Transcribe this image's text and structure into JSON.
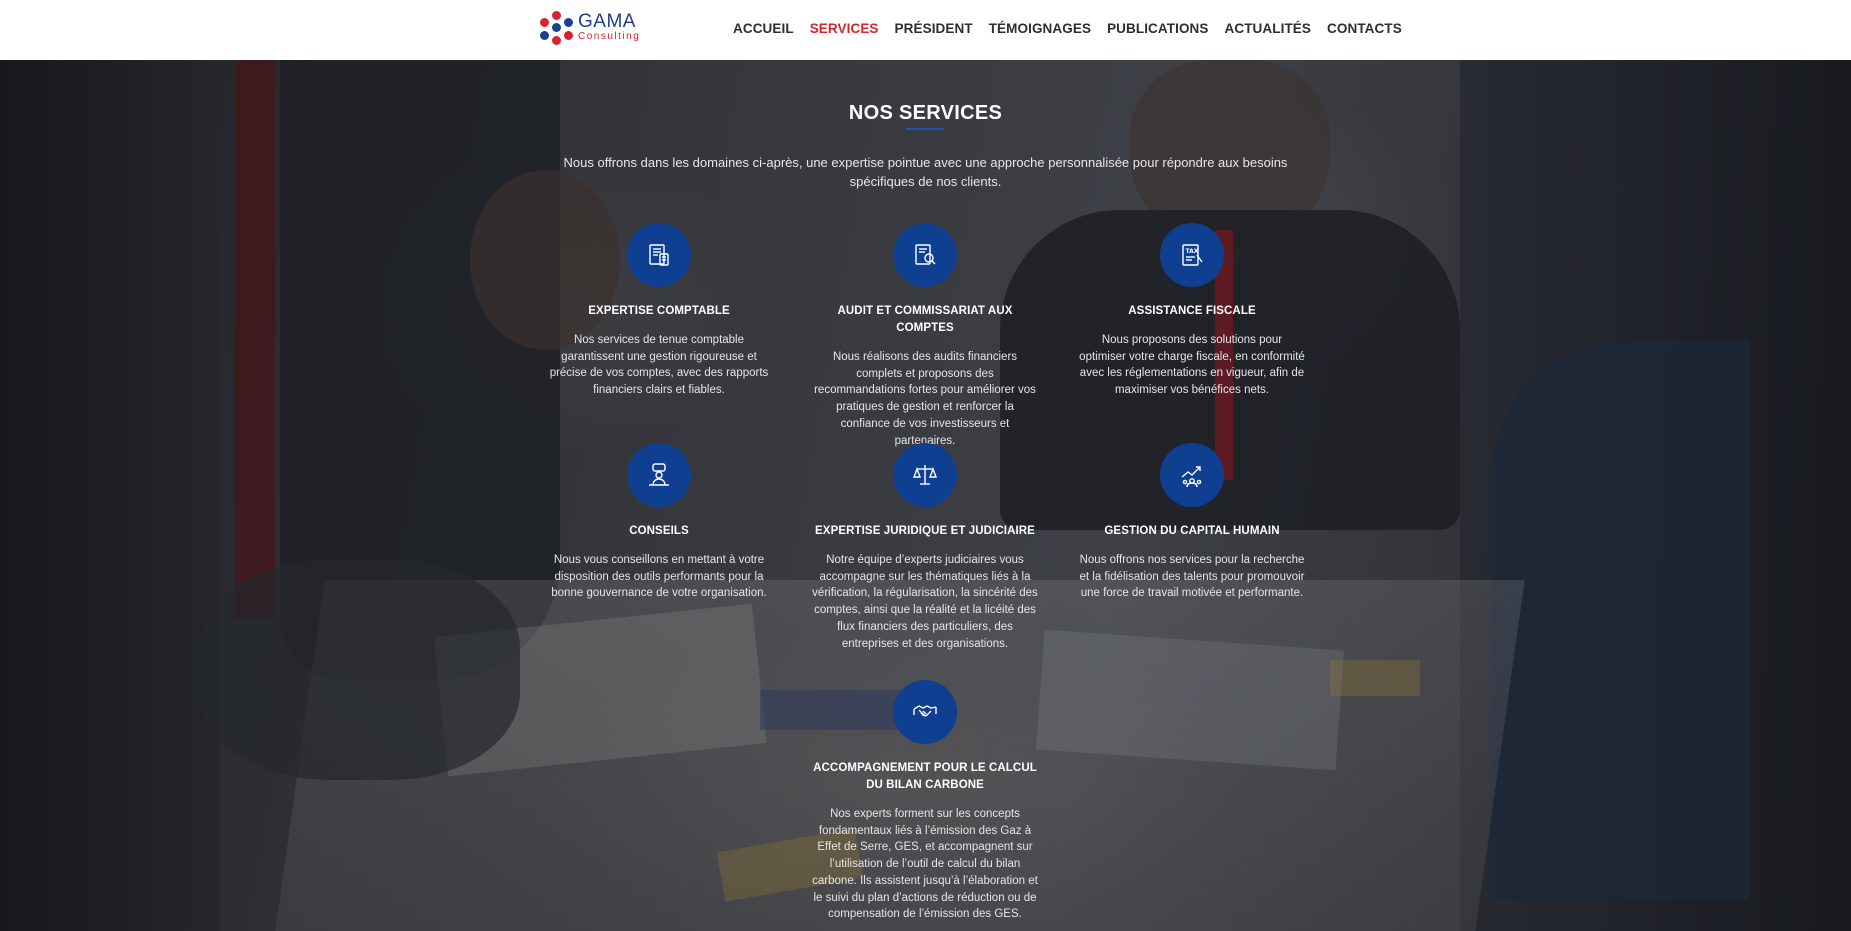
{
  "header": {
    "logo": {
      "title": "GAMA",
      "subtitle": "Consulting",
      "tagline": ""
    },
    "nav": [
      {
        "label": "ACCUEIL",
        "active": false
      },
      {
        "label": "SERVICES",
        "active": true
      },
      {
        "label": "PRÉSIDENT",
        "active": false
      },
      {
        "label": "TÉMOIGNAGES",
        "active": false
      },
      {
        "label": "PUBLICATIONS",
        "active": false
      },
      {
        "label": "ACTUALITÉS",
        "active": false
      },
      {
        "label": "CONTACTS",
        "active": false
      }
    ]
  },
  "section": {
    "title": "NOS SERVICES",
    "intro": "Nous offrons dans les domaines ci-après, une expertise pointue avec une approche personnalisée pour répondre aux besoins spécifiques de nos clients."
  },
  "services": [
    {
      "icon": "accounting-icon",
      "title": "EXPERTISE COMPTABLE",
      "description": "Nos services de tenue comptable garantissent une gestion rigoureuse et précise de vos comptes, avec des rapports financiers clairs et fiables."
    },
    {
      "icon": "audit-icon",
      "title": "AUDIT ET COMMISSARIAT AUX COMPTES",
      "description": "Nous réalisons des audits financiers complets et proposons des recommandations fortes pour améliorer vos pratiques de gestion et renforcer la confiance de vos investisseurs et partenaires."
    },
    {
      "icon": "tax-icon",
      "title": "ASSISTANCE FISCALE",
      "description": "Nous proposons des solutions pour optimiser votre charge fiscale, en conformité avec les réglementations en vigueur, afin de maximiser vos bénéfices nets."
    },
    {
      "icon": "consulting-icon",
      "title": "CONSEILS",
      "description": "Nous vous conseillons en mettant à votre disposition des outils performants pour la bonne gouvernance de votre organisation."
    },
    {
      "icon": "scales-icon",
      "title": "EXPERTISE JURIDIQUE ET JUDICIAIRE",
      "description": "Notre équipe d’experts judiciaires vous accompagne sur les thématiques liés à la vérification, la régularisation, la sincérité des comptes, ainsi que la réalité et la licéité des flux financiers des particuliers, des entreprises et des organisations."
    },
    {
      "icon": "growth-icon",
      "title": "GESTION DU CAPITAL HUMAIN",
      "description": "Nous offrons nos services pour la recherche et la fidélisation des talents pour promouvoir une force de travail motivée et performante."
    },
    {
      "icon": "handshake-icon",
      "title": "ACCOMPAGNEMENT POUR LE CALCUL DU BILAN CARBONE",
      "description": "Nos experts forment sur les concepts fondamentaux liés à l’émission des Gaz à Effet de Serre, GES, et accompagnent sur l’utilisation de l’outil de calcul du bilan carbone. Ils assistent jusqu’à l’élaboration et le suivi du plan d’actions de réduction ou de compensation de l’émission des GES."
    }
  ],
  "colors": {
    "brand_blue": "#0f3f91",
    "brand_red": "#d6242f",
    "nav_text": "#2e2e2e"
  }
}
